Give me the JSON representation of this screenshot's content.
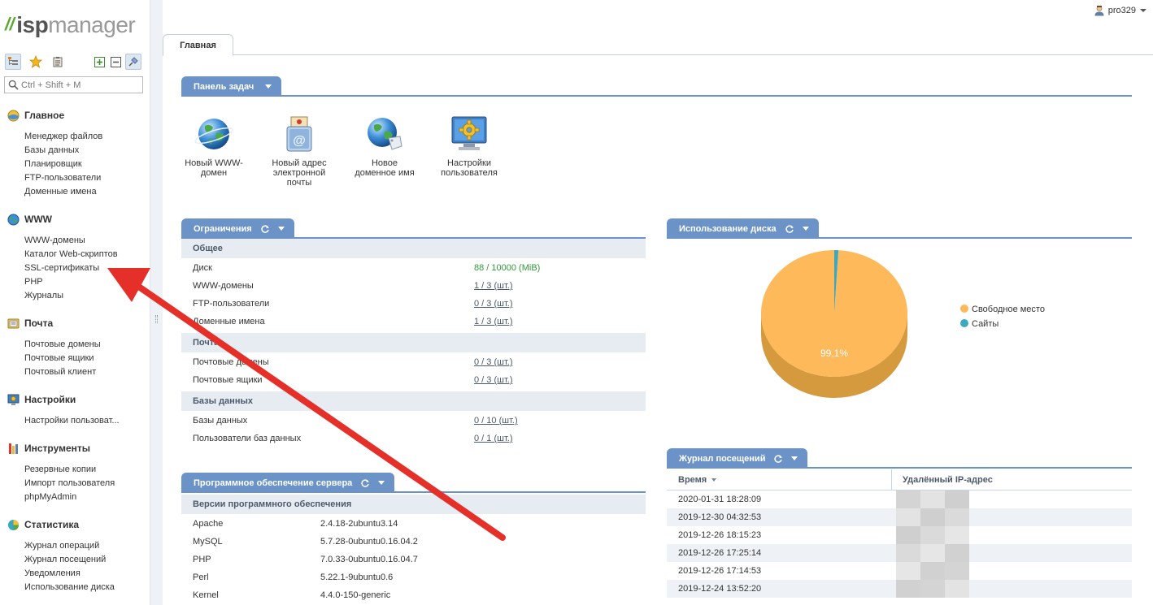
{
  "app": {
    "logo_prefix": "isp",
    "logo_suffix": "manager",
    "user": "pro329"
  },
  "sidebar": {
    "search_placeholder": "Ctrl + Shift + M",
    "groups": [
      {
        "title": "Главное",
        "icon": "home-globe-icon",
        "items": [
          "Менеджер файлов",
          "Базы данных",
          "Планировщик",
          "FTP-пользователи",
          "Доменные имена"
        ]
      },
      {
        "title": "WWW",
        "icon": "www-globe-icon",
        "items": [
          "WWW-домены",
          "Каталог Web-скриптов",
          "SSL-сертификаты",
          "PHP",
          "Журналы"
        ]
      },
      {
        "title": "Почта",
        "icon": "mail-icon",
        "items": [
          "Почтовые домены",
          "Почтовые ящики",
          "Почтовый клиент"
        ]
      },
      {
        "title": "Настройки",
        "icon": "settings-monitor-icon",
        "items": [
          "Настройки пользоват..."
        ]
      },
      {
        "title": "Инструменты",
        "icon": "tools-icon",
        "items": [
          "Резервные копии",
          "Импорт пользователя",
          "phpMyAdmin"
        ]
      },
      {
        "title": "Статистика",
        "icon": "statistics-pie-icon",
        "items": [
          "Журнал операций",
          "Журнал посещений",
          "Уведомления",
          "Использование диска"
        ]
      }
    ]
  },
  "tabs": [
    {
      "label": "Главная"
    }
  ],
  "taskbar": {
    "title": "Панель задач",
    "tasks": [
      {
        "label": "Новый WWW-домен",
        "icon": "globe-icon"
      },
      {
        "label": "Новый адрес электронной почты",
        "icon": "mail-address-icon"
      },
      {
        "label": "Новое доменное имя",
        "icon": "domain-tag-globe-icon"
      },
      {
        "label": "Настройки пользователя",
        "icon": "user-settings-gear-icon"
      }
    ]
  },
  "limits": {
    "title": "Ограничения",
    "sections": [
      {
        "title": "Общее",
        "rows": [
          {
            "label": "Диск",
            "value": "88 / 10000 (MiB)",
            "style": "green"
          },
          {
            "label": "WWW-домены",
            "value": "1 / 3 (шт.)"
          },
          {
            "label": "FTP-пользователи",
            "value": "0 / 3 (шт.)"
          },
          {
            "label": "Доменные имена",
            "value": "1 / 3 (шт.)"
          }
        ]
      },
      {
        "title": "Почта",
        "rows": [
          {
            "label": "Почтовые домены",
            "value": "0 / 3 (шт.)"
          },
          {
            "label": "Почтовые ящики",
            "value": "0 / 3 (шт.)"
          }
        ]
      },
      {
        "title": "Базы данных",
        "rows": [
          {
            "label": "Базы данных",
            "value": "0 / 10 (шт.)"
          },
          {
            "label": "Пользователи баз данных",
            "value": "0 / 1 (шт.)"
          }
        ]
      }
    ]
  },
  "software": {
    "title": "Программное обеспечение сервера",
    "section": "Версии программного обеспечения",
    "rows": [
      {
        "name": "Apache",
        "version": "2.4.18-2ubuntu3.14"
      },
      {
        "name": "MySQL",
        "version": "5.7.28-0ubuntu0.16.04.2"
      },
      {
        "name": "PHP",
        "version": "7.0.33-0ubuntu0.16.04.7"
      },
      {
        "name": "Perl",
        "version": "5.22.1-9ubuntu0.6"
      },
      {
        "name": "Kernel",
        "version": "4.4.0-150-generic"
      }
    ]
  },
  "disk": {
    "title": "Использование диска"
  },
  "visits": {
    "title": "Журнал посещений",
    "columns": [
      "Время",
      "Удалённый IP-адрес"
    ],
    "rows": [
      "2020-01-31 18:28:09",
      "2019-12-30 04:32:53",
      "2019-12-26 18:15:23",
      "2019-12-26 17:25:14",
      "2019-12-26 17:14:53",
      "2019-12-24 13:52:20"
    ]
  },
  "colors": {
    "accent": "#6b93c7",
    "free_space": "#fdb95a",
    "free_space_side": "#d69a3e",
    "sites": "#3aa9c0",
    "annotation_arrow": "#e5302a"
  },
  "chart_data": {
    "type": "pie",
    "title": "",
    "categories": [
      "Свободное место",
      "Сайты"
    ],
    "values": [
      99.1,
      0.9
    ],
    "labels": [
      "99,1%",
      ""
    ],
    "legend": "right",
    "grid": false
  }
}
